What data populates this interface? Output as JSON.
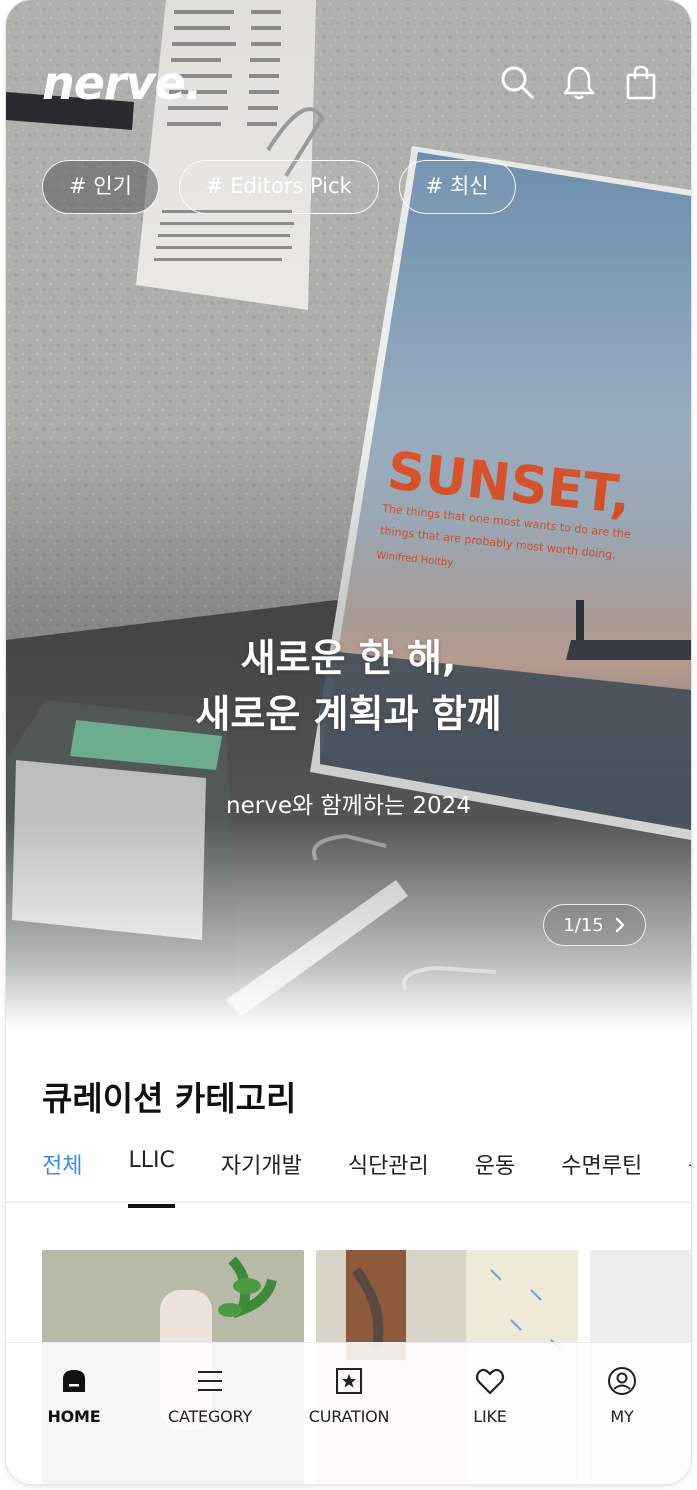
{
  "brand": {
    "logo": "nerve."
  },
  "header": {
    "icons": [
      "search-icon",
      "bell-icon",
      "shopping-bag-icon"
    ]
  },
  "hero": {
    "tags": [
      {
        "label": "# 인기",
        "active": true
      },
      {
        "label": "# Editors Pick",
        "active": false
      },
      {
        "label": "# 최신",
        "active": false,
        "new_dot": true
      }
    ],
    "headline_line1": "새로운 한 해,",
    "headline_line2": "새로운 계획과 함께",
    "subline": "nerve와 함께하는 2024",
    "pager": {
      "text": "1/15",
      "next_icon": "chevron-right-icon"
    },
    "book_title": "SUNSET,",
    "book_subtitle_1": "The things that one most wants to do are the",
    "book_subtitle_2": "things that are probably most worth doing.",
    "book_author": "Winifred Holtby"
  },
  "category": {
    "title": "큐레이션 카테고리",
    "tabs": [
      {
        "label": "전체",
        "state": "blue"
      },
      {
        "label": "LLIC",
        "state": "underlined"
      },
      {
        "label": "자기개발",
        "state": ""
      },
      {
        "label": "식단관리",
        "state": ""
      },
      {
        "label": "운동",
        "state": ""
      },
      {
        "label": "수면루틴",
        "state": ""
      },
      {
        "label": "독서",
        "state": ""
      }
    ]
  },
  "bottom_nav": {
    "items": [
      {
        "label": "HOME",
        "icon": "home-icon",
        "active": true
      },
      {
        "label": "CATEGORY",
        "icon": "menu-icon",
        "active": false
      },
      {
        "label": "CURATION",
        "icon": "star-frame-icon",
        "active": false
      },
      {
        "label": "LIKE",
        "icon": "heart-icon",
        "active": false
      },
      {
        "label": "MY",
        "icon": "user-circle-icon",
        "active": false
      }
    ]
  },
  "colors": {
    "accent_blue": "#3b8be8",
    "tag_dot": "#e0552d",
    "book_title": "#e0552d"
  }
}
